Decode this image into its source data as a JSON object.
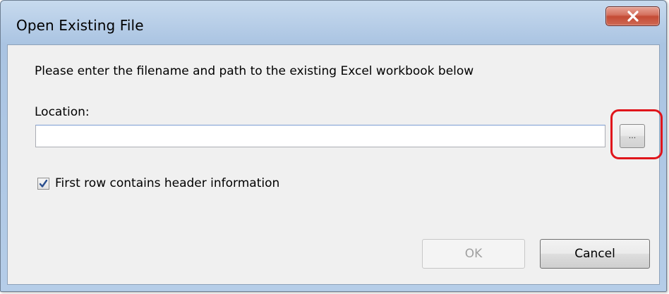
{
  "window": {
    "title": "Open Existing File",
    "close_icon": "close-x-icon"
  },
  "dialog": {
    "instruction": "Please enter the filename and path to the existing Excel workbook below",
    "location_label": "Location:",
    "location_value": "",
    "browse_label": "...",
    "checkbox": {
      "label": "First row contains header information",
      "checked": true
    },
    "ok_label": "OK",
    "ok_enabled": false,
    "cancel_label": "Cancel"
  },
  "colors": {
    "highlight": "#e0151b",
    "close_button": "#c44b35",
    "checkmark": "#2a4f8f"
  }
}
